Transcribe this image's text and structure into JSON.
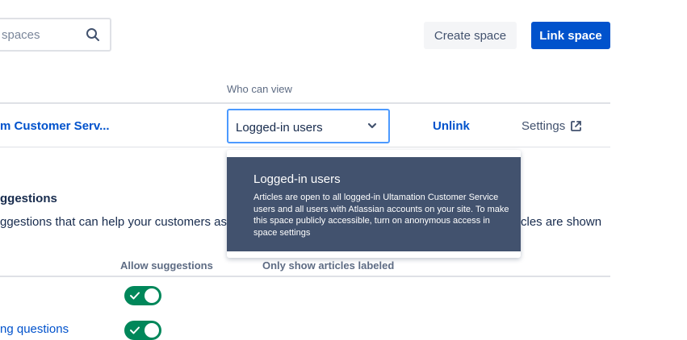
{
  "search": {
    "placeholder": "spaces"
  },
  "toolbar": {
    "create_label": "Create space",
    "link_label": "Link space"
  },
  "table": {
    "who_can_view_header": "Who can view",
    "space_name": "m Customer Serv...",
    "who_can_view_value": "Logged-in users",
    "unlink_label": "Unlink",
    "settings_label": "Settings"
  },
  "popup": {
    "title": "Logged-in users",
    "description": "Articles are open to all logged-in Ultamation Customer Service users and all users with Atlassian accounts on your site. To make this space publicly accessible, turn on anonymous access in space settings"
  },
  "suggestions": {
    "title": "ggestions",
    "description_left": "ggestions that can help your customers as t",
    "description_right": "cles are shown",
    "col_allow": "Allow suggestions",
    "col_only_show": "Only show articles labeled",
    "row2_label": "ng questions"
  },
  "colors": {
    "brand": "#0052CC",
    "toggle_on": "#00875A",
    "popup_bg": "#42526E"
  }
}
